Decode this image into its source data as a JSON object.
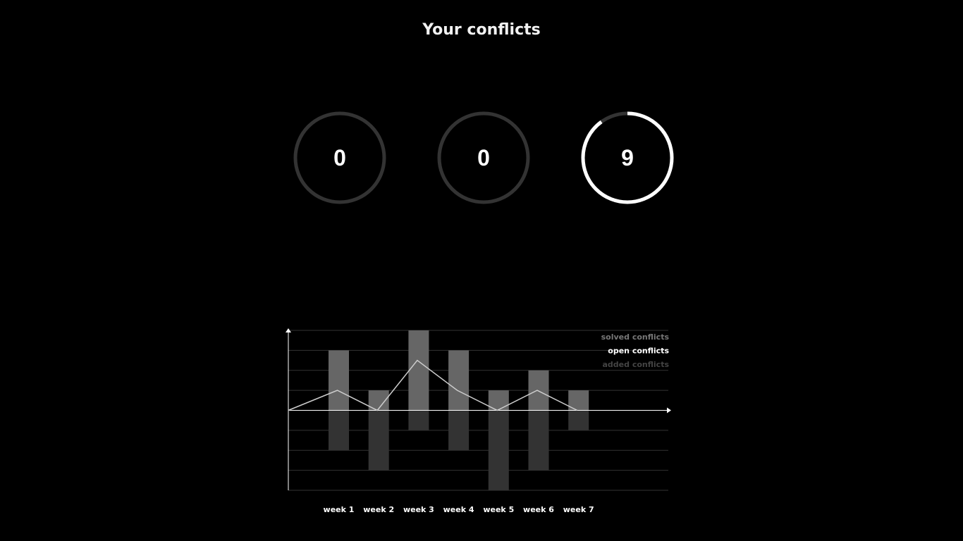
{
  "page": {
    "title": "Your conflicts"
  },
  "counters": [
    {
      "value": "0",
      "progress": 0
    },
    {
      "value": "0",
      "progress": 0
    },
    {
      "value": "9",
      "progress": 0.9
    }
  ],
  "colors": {
    "background": "#000000",
    "ring_track": "#333333",
    "ring_fill": "#ffffff",
    "solved_bar": "#666666",
    "added_bar": "#333333",
    "open_line": "#cccccc",
    "grid": "#333333",
    "axis": "#ffffff",
    "legend_solved": "#777777",
    "legend_open": "#ffffff",
    "legend_added": "#444444"
  },
  "chart_data": {
    "type": "bar",
    "categories": [
      "week 1",
      "week 2",
      "week 3",
      "week 4",
      "week 5",
      "week 6",
      "week 7"
    ],
    "series": [
      {
        "name": "solved conflicts",
        "type": "bar",
        "values": [
          3,
          1,
          4,
          3,
          1,
          2,
          1
        ]
      },
      {
        "name": "open conflicts",
        "type": "line",
        "values": [
          1,
          0,
          2.5,
          1,
          0,
          1,
          0
        ]
      },
      {
        "name": "added conflicts",
        "type": "bar",
        "values": [
          -2,
          -3,
          -1,
          -2,
          -4,
          -3,
          -1
        ]
      }
    ],
    "ylim": [
      -4,
      4
    ],
    "grid": true,
    "legend": "top-right"
  }
}
